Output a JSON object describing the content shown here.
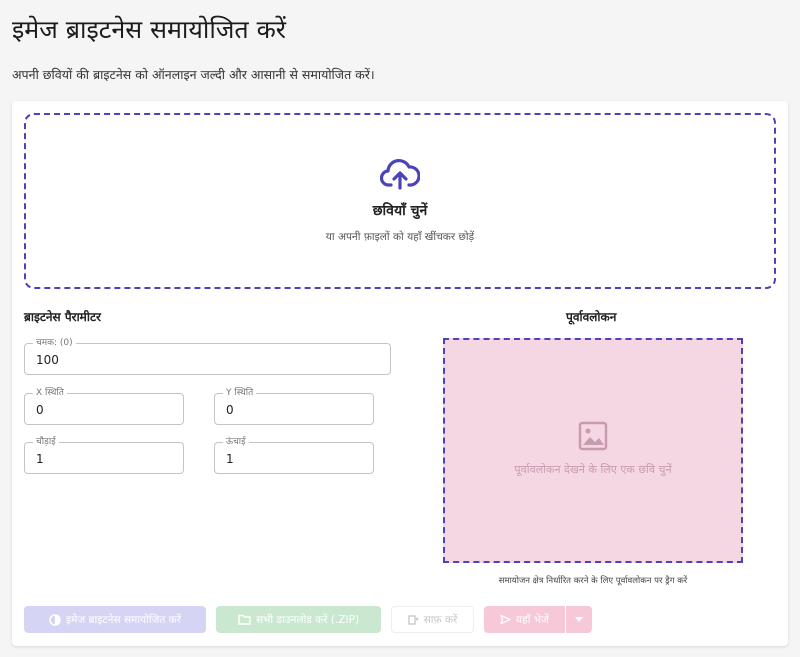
{
  "header": {
    "title": "इमेज ब्राइटनेस समायोजित करें",
    "subtitle": "अपनी छवियों की ब्राइटनेस को ऑनलाइन जल्दी और आसानी से समायोजित करें।"
  },
  "dropzone": {
    "icon": "cloud-upload-icon",
    "title": "छवियाँ चुनें",
    "hint": "या अपनी फ़ाइलों को यहाँ खींचकर छोड़ें"
  },
  "params": {
    "heading": "ब्राइटनेस पैरामीटर",
    "brightness": {
      "label": "चमक: (0)",
      "value": "100"
    },
    "x": {
      "label": "X स्थिति",
      "value": "0"
    },
    "y": {
      "label": "Y स्थिति",
      "value": "0"
    },
    "width": {
      "label": "चौड़ाई",
      "value": "1"
    },
    "height": {
      "label": "ऊंचाई",
      "value": "1"
    }
  },
  "preview": {
    "heading": "पूर्वावलोकन",
    "placeholder": "पूर्वावलोकन देखने के लिए एक छवि चुनें",
    "hint": "समायोजन क्षेत्र निर्धारित करने के लिए पूर्वावलोकन पर ड्रैग करें",
    "icon": "image-icon"
  },
  "actions": {
    "adjust": "इमेज ब्राइटनेस समायोजित करें",
    "download": "सभी डाउनलोड करें (.ZIP)",
    "clear": "साफ़ करें",
    "send": "यहाँ भेजें"
  },
  "colors": {
    "accent": "#4b43b8",
    "preview_bg": "#f4d7e2",
    "adjust_disabled": "#d6d4f4",
    "download_disabled": "#c9e8cf",
    "send_disabled": "#f7c8d8"
  }
}
